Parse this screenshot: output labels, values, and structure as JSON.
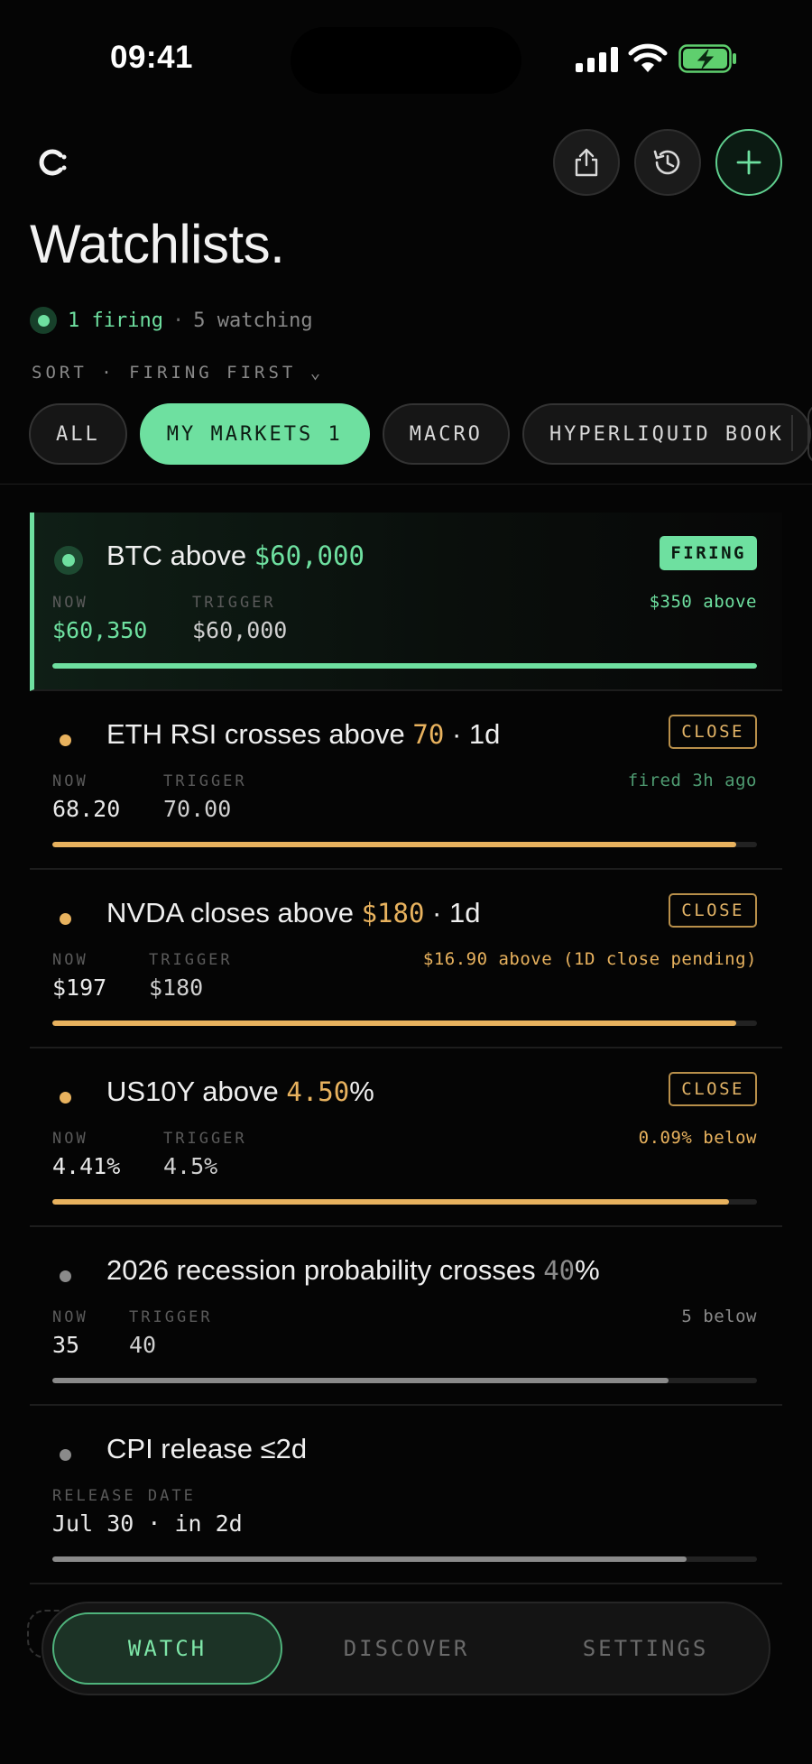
{
  "status": {
    "time": "09:41"
  },
  "header": {
    "title": "Watchlists.",
    "summary": {
      "firing": "1 firing",
      "sep": "·",
      "watching": "5 watching"
    },
    "sort": "SORT · FIRING FIRST ⌄",
    "icons": [
      "logo-icon",
      "share-icon",
      "history-icon",
      "plus-icon"
    ]
  },
  "chips": [
    {
      "label": "ALL",
      "active": false
    },
    {
      "label": "MY MARKETS 1",
      "active": true
    },
    {
      "label": "MACRO",
      "active": false
    },
    {
      "label": "HYPERLIQUID BOOK",
      "active": false
    }
  ],
  "alerts": [
    {
      "title_pre": "BTC above ",
      "title_hl": "$60,000",
      "title_post": "",
      "badge": "FIRING",
      "label1": "NOW",
      "value1": "$60,350",
      "label2": "TRIGGER",
      "value2": "$60,000",
      "note": "$350 above",
      "progress": 1.0,
      "accent": "#6ee0a0"
    },
    {
      "title_pre": "ETH RSI crosses above ",
      "title_hl": "70",
      "title_post": " · 1d",
      "badge": "CLOSE",
      "label1": "NOW",
      "value1": "68.20",
      "label2": "TRIGGER",
      "value2": "70.00",
      "note": "fired 3h ago",
      "progress": 0.97,
      "accent": "#e8b25e"
    },
    {
      "title_pre": "NVDA closes above ",
      "title_hl": "$180",
      "title_post": " · 1d",
      "badge": "CLOSE",
      "label1": "NOW",
      "value1": "$197",
      "label2": "TRIGGER",
      "value2": "$180",
      "note": "$16.90 above (1D close pending)",
      "progress": 0.97,
      "accent": "#e8b25e"
    },
    {
      "title_pre": "US10Y above ",
      "title_hl": "4.50",
      "title_post": "%",
      "badge": "CLOSE",
      "label1": "NOW",
      "value1": "4.41%",
      "label2": "TRIGGER",
      "value2": "4.5%",
      "note": "0.09% below",
      "progress": 0.96,
      "accent": "#e8b25e"
    },
    {
      "title_pre": "2026 recession probability crosses ",
      "title_hl": "40",
      "title_post": "%",
      "badge": "",
      "label1": "NOW",
      "value1": "35",
      "label2": "TRIGGER",
      "value2": "40",
      "note": "5 below",
      "progress": 0.875,
      "accent": "#8a8a8a"
    },
    {
      "title_pre": "CPI release ≤2d",
      "title_hl": "",
      "title_post": "",
      "badge": "",
      "label1": "RELEASE DATE",
      "value1": "Jul 30 · in 2d",
      "label2": "",
      "value2": "",
      "note": "",
      "progress": 0.9,
      "accent": "#8a8a8a"
    }
  ],
  "tabbar": {
    "watch": "WATCH",
    "discover": "DISCOVER",
    "settings": "SETTINGS"
  },
  "colors": {
    "accent": "#6ee0a0",
    "warn": "#e8b25e",
    "muted": "#8a8a8a",
    "bg": "#050505"
  }
}
